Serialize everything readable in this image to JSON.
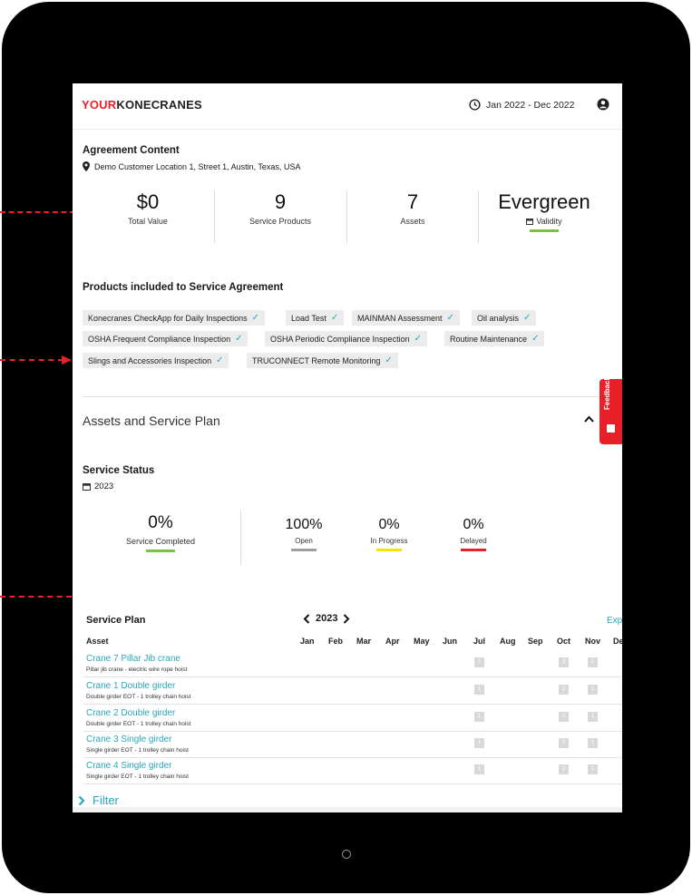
{
  "header": {
    "logo_part1": "YOUR",
    "logo_part2": "KONECRANES",
    "date_range": "Jan 2022 - Dec 2022",
    "icons": {
      "clock": "clock-icon",
      "user": "user-account-icon"
    }
  },
  "agreement": {
    "title": "Agreement Content",
    "location": "Demo Customer Location 1, Street 1, Austin, Texas, USA",
    "kpis": [
      {
        "value": "$0",
        "label": "Total Value"
      },
      {
        "value": "9",
        "label": "Service Products"
      },
      {
        "value": "7",
        "label": "Assets"
      },
      {
        "value": "Evergreen",
        "label": "Validity"
      }
    ]
  },
  "products": {
    "title": "Products included to Service Agreement",
    "items": [
      "Konecranes CheckApp for Daily Inspections",
      "Load Test",
      "MAINMAN Assessment",
      "Oil analysis",
      "OSHA Frequent Compliance Inspection",
      "OSHA Periodic Compliance Inspection",
      "Routine Maintenance",
      "Slings and Accessories Inspection",
      "TRUCONNECT Remote Monitoring"
    ]
  },
  "assets_section": {
    "title": "Assets and Service Plan"
  },
  "feedback": {
    "label": "Feedback"
  },
  "service_status": {
    "title": "Service Status",
    "year": "2023",
    "completed": {
      "value": "0%",
      "label": "Service Completed"
    },
    "stats": [
      {
        "value": "100%",
        "label": "Open",
        "color": "#9e9e9e"
      },
      {
        "value": "0%",
        "label": "In Progress",
        "color": "#f2e500"
      },
      {
        "value": "0%",
        "label": "Delayed",
        "color": "#e8202a"
      }
    ],
    "completed_color": "#7cc242"
  },
  "service_plan": {
    "title": "Service Plan",
    "year": "2023",
    "export_label": "Exp",
    "asset_header": "Asset",
    "months": [
      "Jan",
      "Feb",
      "Mar",
      "Apr",
      "May",
      "Jun",
      "Jul",
      "Aug",
      "Sep",
      "Oct",
      "Nov",
      "De"
    ],
    "rows": [
      {
        "name": "Crane 7 Pillar Jib crane",
        "desc": "Pillar jib crane - electric wire rope hoist",
        "jul": "1",
        "oct": "3",
        "nov": "1"
      },
      {
        "name": "Crane 1 Double girder",
        "desc": "Double girder EOT - 1 trolley chain hoist",
        "jul": "1",
        "oct": "2",
        "nov": "1"
      },
      {
        "name": "Crane 2 Double girder",
        "desc": "Double girder EOT - 1 trolley chain hoist",
        "jul": "1",
        "oct": "2",
        "nov": "1"
      },
      {
        "name": "Crane 3 Single girder",
        "desc": "Single girder EOT - 1 trolley chain hoist",
        "jul": "1",
        "oct": "2",
        "nov": "1"
      },
      {
        "name": "Crane 4 Single girder",
        "desc": "Single girder EOT - 1 trolley chain hoist",
        "jul": "1",
        "oct": "2",
        "nov": "1"
      }
    ]
  },
  "filter": {
    "label": "Filter"
  },
  "colors": {
    "brand_red": "#e8202a",
    "accent_teal": "#2aa7b8",
    "chip_bg": "#ececec"
  }
}
